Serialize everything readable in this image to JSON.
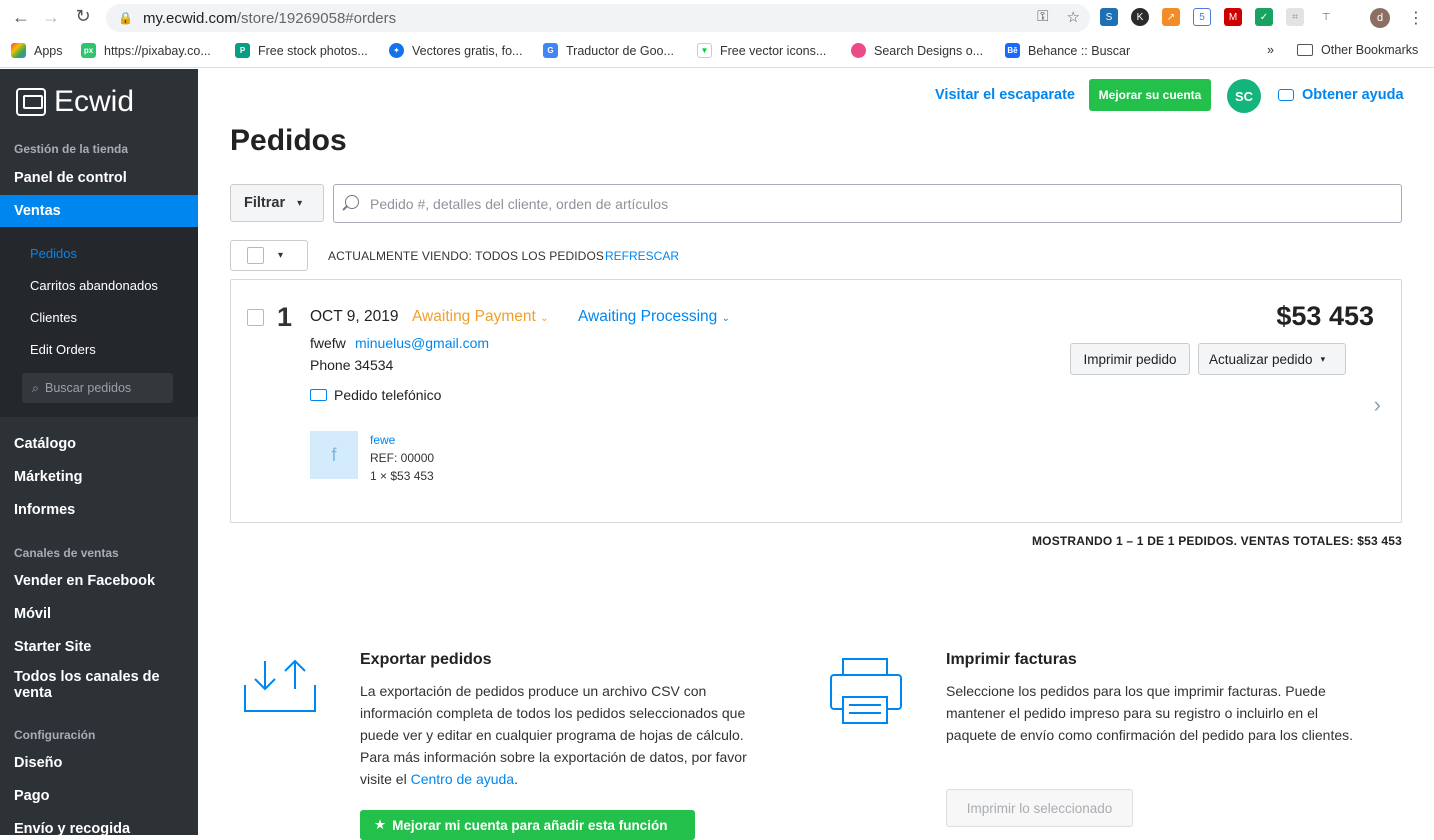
{
  "browser": {
    "url_host": "my.ecwid.com",
    "url_path": "/store/19269058#orders",
    "bookmarks": [
      {
        "label": "Apps"
      },
      {
        "label": "https://pixabay.co..."
      },
      {
        "label": "Free stock photos..."
      },
      {
        "label": "Vectores gratis, fo..."
      },
      {
        "label": "Traductor de Goo..."
      },
      {
        "label": "Free vector icons..."
      },
      {
        "label": "Search Designs o..."
      },
      {
        "label": "Behance :: Buscar"
      }
    ],
    "bookmark_more": "»",
    "other_bookmarks": "Other Bookmarks",
    "profile_initial": "d"
  },
  "sidebar": {
    "logo_text": "Ecwid",
    "section_store": "Gestión de la tienda",
    "dashboard": "Panel de control",
    "sales": "Ventas",
    "sub_items": [
      "Pedidos",
      "Carritos abandonados",
      "Clientes",
      "Edit Orders"
    ],
    "search_placeholder": "Buscar pedidos",
    "catalog": "Catálogo",
    "marketing": "Márketing",
    "reports": "Informes",
    "section_channels": "Canales de ventas",
    "facebook": "Vender en Facebook",
    "mobile": "Móvil",
    "starter": "Starter Site",
    "all_channels": "Todos los canales de venta",
    "section_config": "Configuración",
    "design": "Diseño",
    "payment": "Pago",
    "shipping": "Envío y recogida"
  },
  "topbar": {
    "visit_store": "Visitar el escaparate",
    "upgrade": "Mejorar su cuenta",
    "avatar": "SC",
    "help": "Obtener ayuda"
  },
  "main": {
    "title": "Pedidos",
    "filter_label": "Filtrar",
    "search_placeholder": "Pedido #, detalles del cliente, orden de artículos",
    "viewing": "ACTUALMENTE VIENDO: TODOS LOS PEDIDOS",
    "refresh": "REFRESCAR"
  },
  "order": {
    "number": "1",
    "date": "OCT 9, 2019",
    "payment_status": "Awaiting Payment",
    "fulfillment_status": "Awaiting Processing",
    "customer_name": "fwefw",
    "customer_email": "minuelus@gmail.com",
    "phone": "Phone 34534",
    "type": "Pedido telefónico",
    "item_thumb": "f",
    "item_name": "fewe",
    "item_ref": "REF: 00000",
    "item_qty": "1 × $53 453",
    "total": "$53 453",
    "print_btn": "Imprimir pedido",
    "update_btn": "Actualizar pedido"
  },
  "summary": "MOSTRANDO 1 – 1 DE 1 PEDIDOS. VENTAS TOTALES: $53 453",
  "export": {
    "title": "Exportar pedidos",
    "text": "La exportación de pedidos produce un archivo CSV con información completa de todos los pedidos seleccionados que puede ver y editar en cualquier programa de hojas de cálculo. Para más información sobre la exportación de datos, por favor visite el",
    "link": "Centro de ayuda",
    "after_link": ".",
    "cta": "Mejorar mi cuenta para añadir esta función"
  },
  "invoices": {
    "title": "Imprimir facturas",
    "text": "Seleccione los pedidos para los que imprimir facturas. Puede mantener el pedido impreso para su registro o incluirlo en el paquete de envío como confirmación del pedido para los clientes.",
    "button": "Imprimir lo seleccionado"
  },
  "colors": {
    "accent": "#0087ef",
    "green": "#23c14b",
    "sidebar": "#2d3237",
    "payment_orange": "#f29f2a"
  }
}
